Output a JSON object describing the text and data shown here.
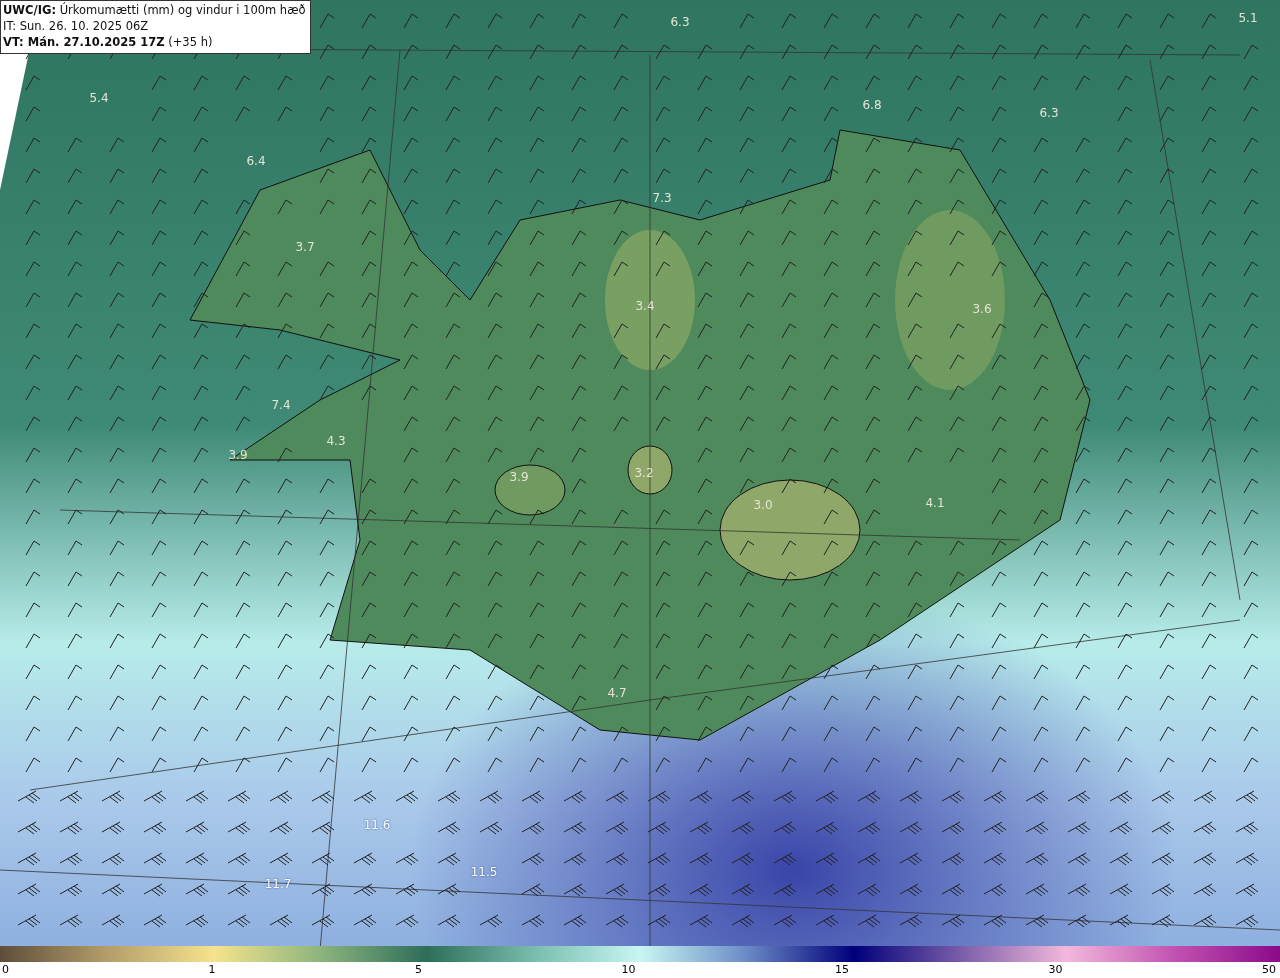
{
  "header": {
    "line_1": "**UWC/IG:** Úrkomumætti (mm) og vindur i 100m hæð",
    "line_2": "IT: Sun. 26. 10. 2025 06Z",
    "line_3": "**VT: Mán. 27.10.2025 17Z** (+35 h)"
  },
  "map_labels": [
    "6.3",
    "5.1",
    "5.4",
    "6.8",
    "6.3",
    "6.4",
    "7.3",
    "3.7",
    "3.4",
    "3.6",
    "7.4",
    "4.3",
    "3.9",
    "3.9",
    "3.2",
    "3.0",
    "4.1",
    "4.7",
    "11.6",
    "11.5",
    "11.7"
  ],
  "colorbar": {
    "ticks": [
      "0",
      "1",
      "5",
      "10",
      "15",
      "30",
      "50"
    ]
  }
}
